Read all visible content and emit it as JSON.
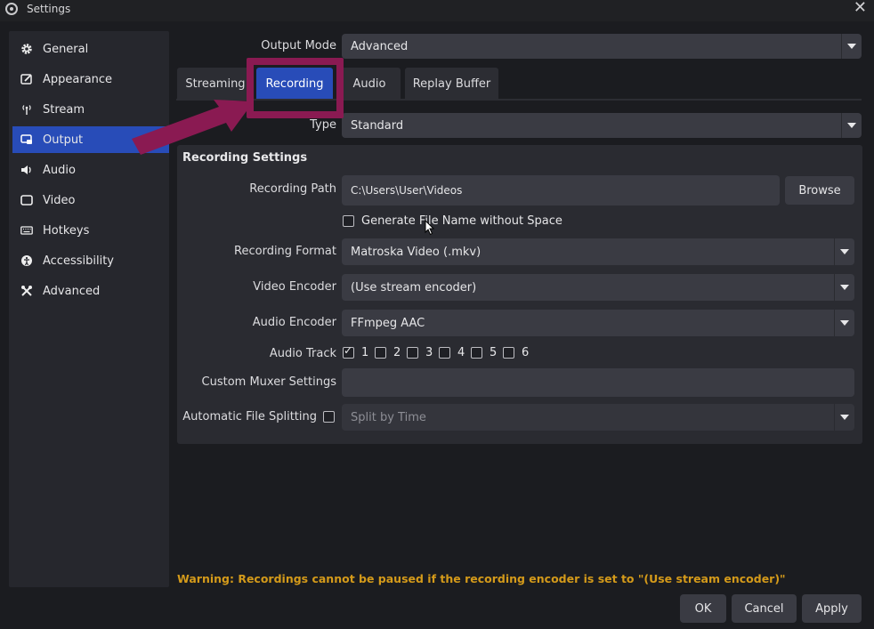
{
  "window": {
    "title": "Settings",
    "close_glyph": "✕"
  },
  "sidebar": {
    "items": [
      {
        "label": "General",
        "icon": "gear-icon",
        "active": false
      },
      {
        "label": "Appearance",
        "icon": "appearance-icon",
        "active": false
      },
      {
        "label": "Stream",
        "icon": "antenna-icon",
        "active": false
      },
      {
        "label": "Output",
        "icon": "output-icon",
        "active": true
      },
      {
        "label": "Audio",
        "icon": "speaker-icon",
        "active": false
      },
      {
        "label": "Video",
        "icon": "monitor-icon",
        "active": false
      },
      {
        "label": "Hotkeys",
        "icon": "keyboard-icon",
        "active": false
      },
      {
        "label": "Accessibility",
        "icon": "accessibility-icon",
        "active": false
      },
      {
        "label": "Advanced",
        "icon": "tools-icon",
        "active": false
      }
    ]
  },
  "output_mode": {
    "label": "Output Mode",
    "value": "Advanced"
  },
  "tabs": [
    {
      "label": "Streaming",
      "active": false
    },
    {
      "label": "Recording",
      "active": true
    },
    {
      "label": "Audio",
      "active": false
    },
    {
      "label": "Replay Buffer",
      "active": false
    }
  ],
  "type": {
    "label": "Type",
    "value": "Standard"
  },
  "recording_settings": {
    "title": "Recording Settings",
    "path_label": "Recording Path",
    "path_value": "C:\\Users\\User\\Videos",
    "browse_label": "Browse",
    "gen_filename_label": "Generate File Name without Space",
    "gen_filename_checked": false,
    "format_label": "Recording Format",
    "format_value": "Matroska Video (.mkv)",
    "video_encoder_label": "Video Encoder",
    "video_encoder_value": "(Use stream encoder)",
    "audio_encoder_label": "Audio Encoder",
    "audio_encoder_value": "FFmpeg AAC",
    "audio_track_label": "Audio Track",
    "tracks": [
      {
        "label": "1",
        "checked": true
      },
      {
        "label": "2",
        "checked": false
      },
      {
        "label": "3",
        "checked": false
      },
      {
        "label": "4",
        "checked": false
      },
      {
        "label": "5",
        "checked": false
      },
      {
        "label": "6",
        "checked": false
      }
    ],
    "muxer_label": "Custom Muxer Settings",
    "muxer_value": "",
    "split_label": "Automatic File Splitting",
    "split_checked": false,
    "split_value": "Split by Time"
  },
  "warning": "Warning: Recordings cannot be paused if the recording encoder is set to \"(Use stream encoder)\"",
  "buttons": {
    "ok": "OK",
    "cancel": "Cancel",
    "apply": "Apply"
  },
  "colors": {
    "accent": "#284cb8",
    "annotation": "#8a1a52",
    "warning": "#d49a1a"
  }
}
